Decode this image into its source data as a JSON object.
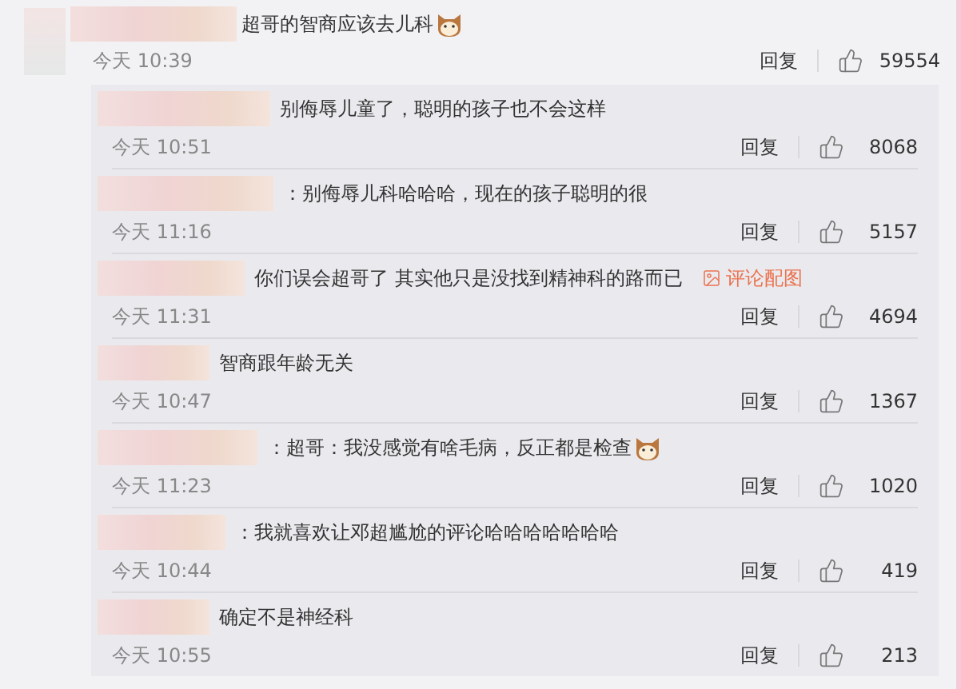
{
  "comment": {
    "text": "超哥的智商应该去儿科",
    "emoji": true,
    "time": "今天 10:39",
    "reply_label": "回复",
    "likes": "59554"
  },
  "replies": [
    {
      "text": "别侮辱儿童了，聪明的孩子也不会这样",
      "emoji": false,
      "time": "今天 10:51",
      "reply_label": "回复",
      "likes": "8068"
    },
    {
      "text": "：别侮辱儿科哈哈哈，现在的孩子聪明的很",
      "emoji": false,
      "time": "今天 11:16",
      "reply_label": "回复",
      "likes": "5157"
    },
    {
      "text": "你们误会超哥了 其实他只是没找到精神科的路而已",
      "emoji": false,
      "image_link": "评论配图",
      "time": "今天 11:31",
      "reply_label": "回复",
      "likes": "4694"
    },
    {
      "text": "智商跟年龄无关",
      "emoji": false,
      "time": "今天 10:47",
      "reply_label": "回复",
      "likes": "1367"
    },
    {
      "text": "：超哥：我没感觉有啥毛病，反正都是检查",
      "emoji": true,
      "time": "今天 11:23",
      "reply_label": "回复",
      "likes": "1020"
    },
    {
      "text": "：我就喜欢让邓超尴尬的评论哈哈哈哈哈哈哈",
      "emoji": false,
      "time": "今天 10:44",
      "reply_label": "回复",
      "likes": "419"
    },
    {
      "text": "确定不是神经科",
      "emoji": false,
      "time": "今天 10:55",
      "reply_label": "回复",
      "likes": "213"
    }
  ]
}
